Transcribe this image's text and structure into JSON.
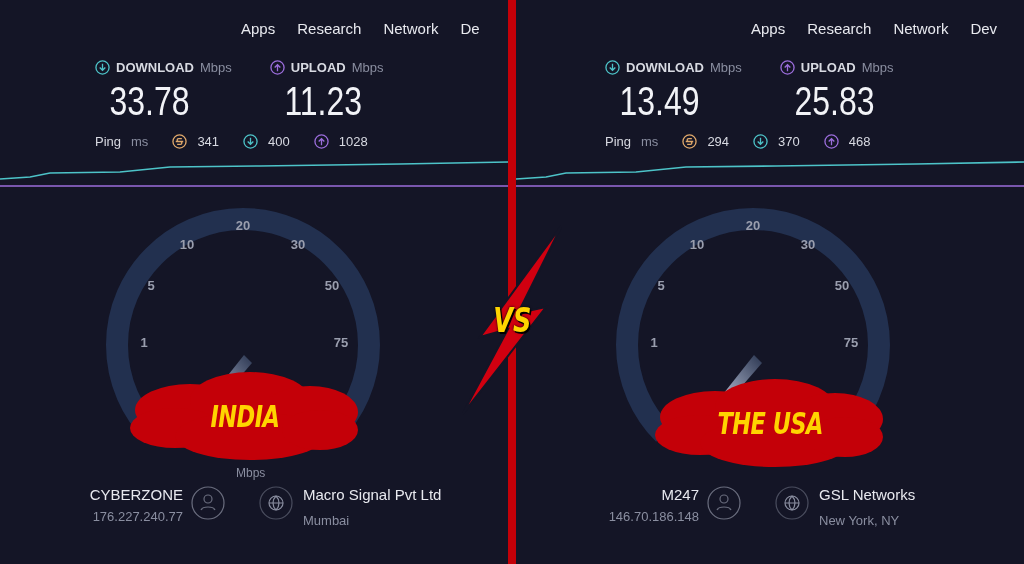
{
  "panels": [
    {
      "nav": [
        "Apps",
        "Research",
        "Network",
        "De"
      ],
      "download": {
        "label": "DOWNLOAD",
        "unit": "Mbps",
        "value": "33.78"
      },
      "upload": {
        "label": "UPLOAD",
        "unit": "Mbps",
        "value": "11.23"
      },
      "ping": {
        "label": "Ping",
        "unit": "ms",
        "idle": "341",
        "down": "400",
        "up": "1028"
      },
      "gauge": {
        "ticks": [
          "1",
          "5",
          "10",
          "20",
          "30",
          "50",
          "75"
        ],
        "unit": "Mbps"
      },
      "tag": "INDIA",
      "user": {
        "name": "CYBERZONE",
        "ip": "176.227.240.77"
      },
      "server": {
        "name": "Macro Signal Pvt Ltd",
        "city": "Mumbai"
      }
    },
    {
      "nav": [
        "Apps",
        "Research",
        "Network",
        "Dev"
      ],
      "download": {
        "label": "DOWNLOAD",
        "unit": "Mbps",
        "value": "13.49"
      },
      "upload": {
        "label": "UPLOAD",
        "unit": "Mbps",
        "value": "25.83"
      },
      "ping": {
        "label": "Ping",
        "unit": "ms",
        "idle": "294",
        "down": "370",
        "up": "468"
      },
      "gauge": {
        "ticks": [
          "1",
          "5",
          "10",
          "20",
          "30",
          "50",
          "75"
        ]
      },
      "tag": "THE USA",
      "user": {
        "name": "M247",
        "ip": "146.70.186.148"
      },
      "server": {
        "name": "GSL Networks",
        "city": "New York, NY"
      }
    }
  ],
  "versus": "VS"
}
